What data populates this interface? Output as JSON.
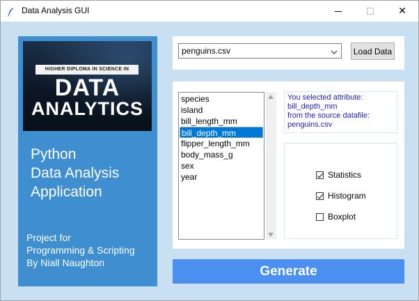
{
  "window": {
    "title": "Data Analysis GUI",
    "icon": "feather-icon",
    "controls": {
      "minimize": "minimize-icon",
      "maximize": "maximize-icon",
      "close": "✕"
    }
  },
  "sidebar": {
    "logo": {
      "strip_text": "HIGHER DIPLOMA IN SCIENCE IN",
      "line1": "DATA",
      "line2": "ANALYTICS"
    },
    "app_title": [
      "Python",
      "Data Analysis",
      "Application"
    ],
    "project": [
      "Project for",
      "Programming & Scripting",
      "By Niall Naughton"
    ]
  },
  "file_select": {
    "value": "penguins.csv",
    "load_label": "Load Data"
  },
  "attributes": {
    "items": [
      "species",
      "island",
      "bill_length_mm",
      "bill_depth_mm",
      "flipper_length_mm",
      "body_mass_g",
      "sex",
      "year"
    ],
    "selected": "bill_depth_mm"
  },
  "info": {
    "line1": "You selected attribute:",
    "line2": "bill_depth_mm",
    "line3": "from the source datafile:",
    "line4": "penguins.csv"
  },
  "options": [
    {
      "label": "Statistics",
      "checked": true
    },
    {
      "label": "Histogram",
      "checked": true
    },
    {
      "label": "Boxplot",
      "checked": false
    }
  ],
  "generate_label": "Generate",
  "colors": {
    "background": "#c9e0f3",
    "sidebar": "#3f8fd0",
    "selection": "#0078d7",
    "info_text": "#1c1cc9",
    "generate": "#4b8ff0"
  }
}
